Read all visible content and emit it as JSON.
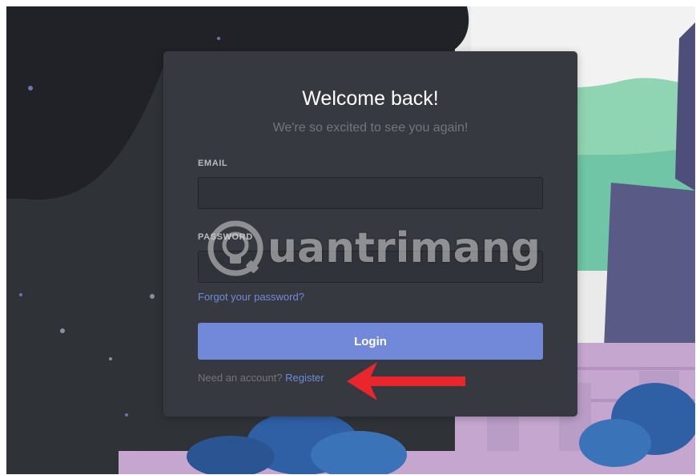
{
  "login": {
    "title": "Welcome back!",
    "subtitle": "We're so excited to see you again!",
    "email_label": "EMAIL",
    "email_value": "",
    "password_label": "PASSWORD",
    "password_value": "",
    "forgot_link": "Forgot your password?",
    "login_button": "Login",
    "need_account": "Need an account?",
    "register_link": "Register"
  },
  "watermark": {
    "text": "uantrimang",
    "icon": "lightbulb-logo-icon"
  },
  "annotation": {
    "icon": "red-arrow-icon",
    "color": "#e8262c"
  },
  "colors": {
    "card_bg": "#36393f",
    "input_bg": "#303339",
    "accent": "#7289da",
    "muted_text": "#72767d",
    "label_text": "#b9bbbe",
    "page_dark": "#2f3338"
  }
}
